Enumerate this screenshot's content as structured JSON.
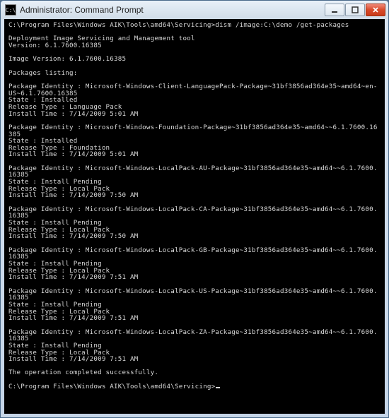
{
  "window": {
    "title": "Administrator: Command Prompt",
    "icon_glyph": "C:\\"
  },
  "terminal": {
    "prompt_path": "C:\\Program Files\\Windows AIK\\Tools\\amd64\\Servicing>",
    "command": "dism /image:C:\\demo /get-packages",
    "header_tool": "Deployment Image Servicing and Management tool",
    "header_version": "Version: 6.1.7600.16385",
    "image_version": "Image Version: 6.1.7600.16385",
    "packages_heading": "Packages listing:",
    "packages": [
      {
        "identity": "Package Identity : Microsoft-Windows-Client-LanguagePack-Package~31bf3856ad364e35~amd64~en-US~6.1.7600.16385",
        "state": "State : Installed",
        "release_type": "Release Type : Language Pack",
        "install_time": "Install Time : 7/14/2009 5:01 AM"
      },
      {
        "identity": "Package Identity : Microsoft-Windows-Foundation-Package~31bf3856ad364e35~amd64~~6.1.7600.16385",
        "state": "State : Installed",
        "release_type": "Release Type : Foundation",
        "install_time": "Install Time : 7/14/2009 5:01 AM"
      },
      {
        "identity": "Package Identity : Microsoft-Windows-LocalPack-AU-Package~31bf3856ad364e35~amd64~~6.1.7600.16385",
        "state": "State : Install Pending",
        "release_type": "Release Type : Local Pack",
        "install_time": "Install Time : 7/14/2009 7:50 AM"
      },
      {
        "identity": "Package Identity : Microsoft-Windows-LocalPack-CA-Package~31bf3856ad364e35~amd64~~6.1.7600.16385",
        "state": "State : Install Pending",
        "release_type": "Release Type : Local Pack",
        "install_time": "Install Time : 7/14/2009 7:50 AM"
      },
      {
        "identity": "Package Identity : Microsoft-Windows-LocalPack-GB-Package~31bf3856ad364e35~amd64~~6.1.7600.16385",
        "state": "State : Install Pending",
        "release_type": "Release Type : Local Pack",
        "install_time": "Install Time : 7/14/2009 7:51 AM"
      },
      {
        "identity": "Package Identity : Microsoft-Windows-LocalPack-US-Package~31bf3856ad364e35~amd64~~6.1.7600.16385",
        "state": "State : Install Pending",
        "release_type": "Release Type : Local Pack",
        "install_time": "Install Time : 7/14/2009 7:51 AM"
      },
      {
        "identity": "Package Identity : Microsoft-Windows-LocalPack-ZA-Package~31bf3856ad364e35~amd64~~6.1.7600.16385",
        "state": "State : Install Pending",
        "release_type": "Release Type : Local Pack",
        "install_time": "Install Time : 7/14/2009 7:51 AM"
      }
    ],
    "footer": "The operation completed successfully."
  }
}
